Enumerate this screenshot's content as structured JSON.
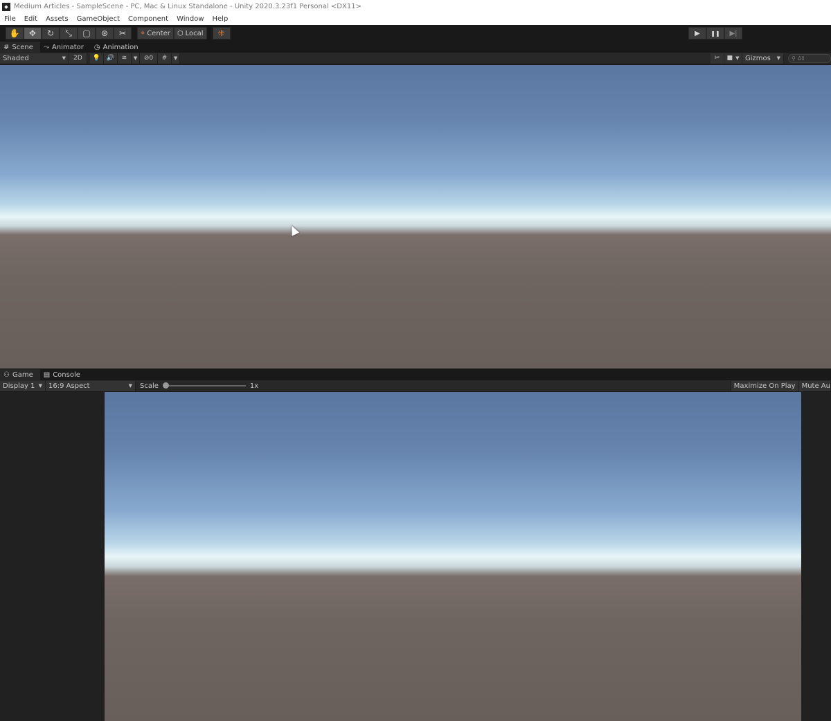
{
  "title": "Medium Articles - SampleScene - PC, Mac & Linux Standalone - Unity 2020.3.23f1 Personal <DX11>",
  "menu": [
    "File",
    "Edit",
    "Assets",
    "GameObject",
    "Component",
    "Window",
    "Help"
  ],
  "toolbar": {
    "tools": [
      "hand-icon",
      "move-icon",
      "rotate-icon",
      "scale-icon",
      "rect-icon",
      "transform-icon",
      "custom-tool-icon"
    ],
    "active_tool": "move-icon",
    "pivot": "Center",
    "space": "Local",
    "play": "▶",
    "pause": "❚❚",
    "step": "▶|"
  },
  "scene_tabs": [
    "Scene",
    "Animator",
    "Animation"
  ],
  "scene_toolbar": {
    "draw_mode": "Shaded",
    "two_d": "2D",
    "hidden_count": "0",
    "gizmos": "Gizmos",
    "search_placeholder": "All"
  },
  "game_tabs": [
    "Game",
    "Console"
  ],
  "game_toolbar": {
    "display": "Display 1",
    "aspect": "16:9 Aspect",
    "scale_label": "Scale",
    "scale_value": "1x",
    "maximize": "Maximize On Play",
    "mute": "Mute Au"
  }
}
